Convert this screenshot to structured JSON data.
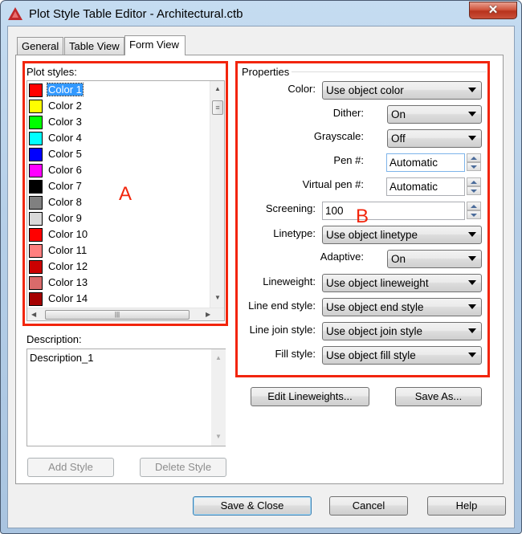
{
  "window": {
    "title": "Plot Style Table Editor - Architectural.ctb",
    "close_label": "✕"
  },
  "tabs": [
    {
      "label": "General",
      "active": false
    },
    {
      "label": "Table View",
      "active": false
    },
    {
      "label": "Form View",
      "active": true
    }
  ],
  "plot_styles": {
    "label": "Plot styles:",
    "selected_index": 0,
    "items": [
      {
        "label": "Color 1",
        "color": "#ff0000"
      },
      {
        "label": "Color 2",
        "color": "#ffff00"
      },
      {
        "label": "Color 3",
        "color": "#00ff00"
      },
      {
        "label": "Color 4",
        "color": "#00ffff"
      },
      {
        "label": "Color 5",
        "color": "#0000ff"
      },
      {
        "label": "Color 6",
        "color": "#ff00ff"
      },
      {
        "label": "Color 7",
        "color": "#000000"
      },
      {
        "label": "Color 8",
        "color": "#808080"
      },
      {
        "label": "Color 9",
        "color": "#d9d9d9"
      },
      {
        "label": "Color 10",
        "color": "#ff0000"
      },
      {
        "label": "Color 11",
        "color": "#ff7f7f"
      },
      {
        "label": "Color 12",
        "color": "#cc0000"
      },
      {
        "label": "Color 13",
        "color": "#d96b6b"
      },
      {
        "label": "Color 14",
        "color": "#a50000"
      }
    ]
  },
  "description": {
    "label": "Description:",
    "value": "Description_1"
  },
  "buttons": {
    "add_style": "Add Style",
    "delete_style": "Delete Style",
    "edit_lineweights": "Edit Lineweights...",
    "save_as": "Save As...",
    "save_close": "Save & Close",
    "cancel": "Cancel",
    "help": "Help"
  },
  "properties": {
    "group_label": "Properties",
    "color": {
      "label": "Color:",
      "value": "Use object color"
    },
    "dither": {
      "label": "Dither:",
      "value": "On"
    },
    "grayscale": {
      "label": "Grayscale:",
      "value": "Off"
    },
    "pen": {
      "label": "Pen #:",
      "value": "Automatic"
    },
    "virtual_pen": {
      "label": "Virtual pen #:",
      "value": "Automatic"
    },
    "screening": {
      "label": "Screening:",
      "value": "100"
    },
    "linetype": {
      "label": "Linetype:",
      "value": "Use object linetype"
    },
    "adaptive": {
      "label": "Adaptive:",
      "value": "On"
    },
    "lineweight": {
      "label": "Lineweight:",
      "value": "Use object lineweight"
    },
    "line_end_style": {
      "label": "Line end style:",
      "value": "Use object end style"
    },
    "line_join_style": {
      "label": "Line join style:",
      "value": "Use object join style"
    },
    "fill_style": {
      "label": "Fill style:",
      "value": "Use object fill style"
    }
  },
  "annotations": {
    "a": "A",
    "b": "B",
    "highlight_color": "#f2250c"
  }
}
